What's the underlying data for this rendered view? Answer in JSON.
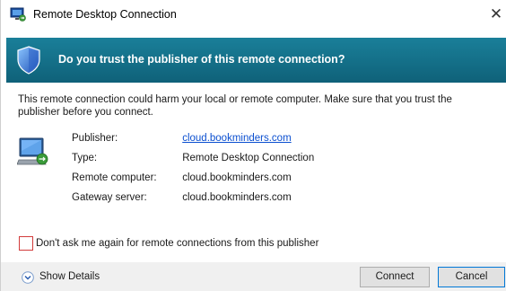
{
  "window": {
    "title": "Remote Desktop Connection",
    "close_glyph": "✕",
    "icon": "remote-desktop-icon"
  },
  "banner": {
    "heading": "Do you trust the publisher of this remote connection?",
    "icon": "shield-icon",
    "color": "#15728b"
  },
  "warning": {
    "text": "This remote connection could harm your local or remote computer. Make sure that you trust the publisher before you connect."
  },
  "details": {
    "icon": "remote-computer-icon",
    "rows": [
      {
        "label": "Publisher:",
        "value": "cloud.bookminders.com",
        "link": true
      },
      {
        "label": "Type:",
        "value": "Remote Desktop Connection",
        "link": false
      },
      {
        "label": "Remote computer:",
        "value": "cloud.bookminders.com",
        "link": false
      },
      {
        "label": "Gateway server:",
        "value": "cloud.bookminders.com",
        "link": false
      }
    ]
  },
  "options": {
    "dont_ask_label": "Don't ask me again for remote connections from this publisher",
    "dont_ask_checked": false
  },
  "footer": {
    "show_details_label": "Show Details",
    "connect_label": "Connect",
    "cancel_label": "Cancel"
  }
}
